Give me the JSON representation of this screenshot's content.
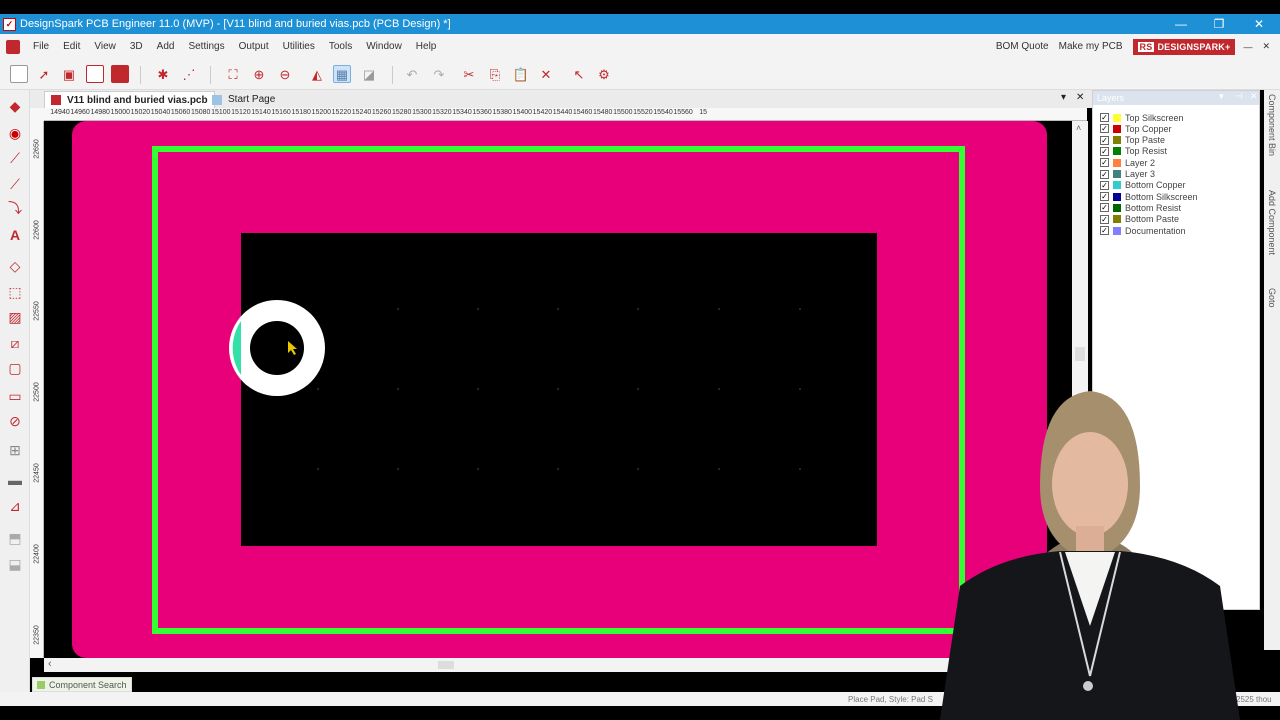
{
  "window": {
    "title": "DesignSpark PCB Engineer 11.0  (MVP) - [V11 blind and buried vias.pcb (PCB Design) *]",
    "app_icon_glyph": "✓",
    "minimize_glyph": "—",
    "restore_glyph": "❐",
    "close_glyph": "✕"
  },
  "menubar": {
    "items": [
      "File",
      "Edit",
      "View",
      "3D",
      "Add",
      "Settings",
      "Output",
      "Utilities",
      "Tools",
      "Window",
      "Help"
    ],
    "bom_quote": "BOM Quote",
    "make_my_pcb": "Make my PCB",
    "logo_rs": "RS",
    "logo_text": "DESIGNSPARK",
    "logo_plus": "+"
  },
  "toolbar": {
    "icons": [
      "new-file-icon",
      "open-icon",
      "save-icon",
      "copy-doc-icon",
      "library-icon",
      "settings-icon",
      "grid-icon",
      "fit-view-icon",
      "zoom-in-icon",
      "zoom-out-icon",
      "fill-icon",
      "grid-toggle-icon",
      "3d-view-icon",
      "undo-icon",
      "redo-icon",
      "cut-icon",
      "copy-icon",
      "paste-icon",
      "delete-icon",
      "select-icon",
      "properties-icon"
    ]
  },
  "tabs": {
    "active": "V11 blind and buried vias.pcb",
    "start_page": "Start Page",
    "dropdown_glyph": "▾",
    "close_glyph": "✕"
  },
  "ruler": {
    "top_ticks": [
      "14940",
      "14960",
      "14980",
      "15000",
      "15020",
      "15040",
      "15060",
      "15080",
      "15100",
      "15120",
      "15140",
      "15160",
      "15180",
      "15200",
      "15220",
      "15240",
      "15260",
      "15280",
      "15300",
      "15320",
      "15340",
      "15360",
      "15380",
      "15400",
      "15420",
      "15440",
      "15460",
      "15480",
      "15500",
      "15520",
      "15540",
      "15560",
      "15"
    ],
    "left_ticks": [
      "22650",
      "22600",
      "22550",
      "22500",
      "22450",
      "22400",
      "22350"
    ]
  },
  "layers": {
    "title": "Layers",
    "pin_glyph": "▾",
    "pin2_glyph": "⊣",
    "close_glyph": "✕",
    "check_glyph": "✓",
    "items": [
      {
        "name": "Top Silkscreen",
        "color": "#ffff33"
      },
      {
        "name": "Top Copper",
        "color": "#cc0000"
      },
      {
        "name": "Top Paste",
        "color": "#808000"
      },
      {
        "name": "Top Resist",
        "color": "#008000"
      },
      {
        "name": "Layer 2",
        "color": "#ff8040"
      },
      {
        "name": "Layer 3",
        "color": "#408080"
      },
      {
        "name": "Bottom Copper",
        "color": "#33cccc"
      },
      {
        "name": "Bottom Silkscreen",
        "color": "#000099"
      },
      {
        "name": "Bottom Resist",
        "color": "#006600"
      },
      {
        "name": "Bottom Paste",
        "color": "#808000"
      },
      {
        "name": "Documentation",
        "color": "#8080ff"
      }
    ]
  },
  "side_tabs": [
    "Component Bin",
    "Add Component",
    "Goto"
  ],
  "status": {
    "component_search": "Component Search",
    "place_pad": "Place Pad, Style: Pad S",
    "coords": "2525 thou",
    "scroll_left_glyph": "‹",
    "scroll_up_glyph": "˄"
  },
  "colors": {
    "board_pink": "#e8007a",
    "board_outline_green": "#33ff33",
    "pad_white": "#ffffff",
    "pad_teal": "#33e0a8",
    "cursor_yellow": "#e6c800"
  }
}
